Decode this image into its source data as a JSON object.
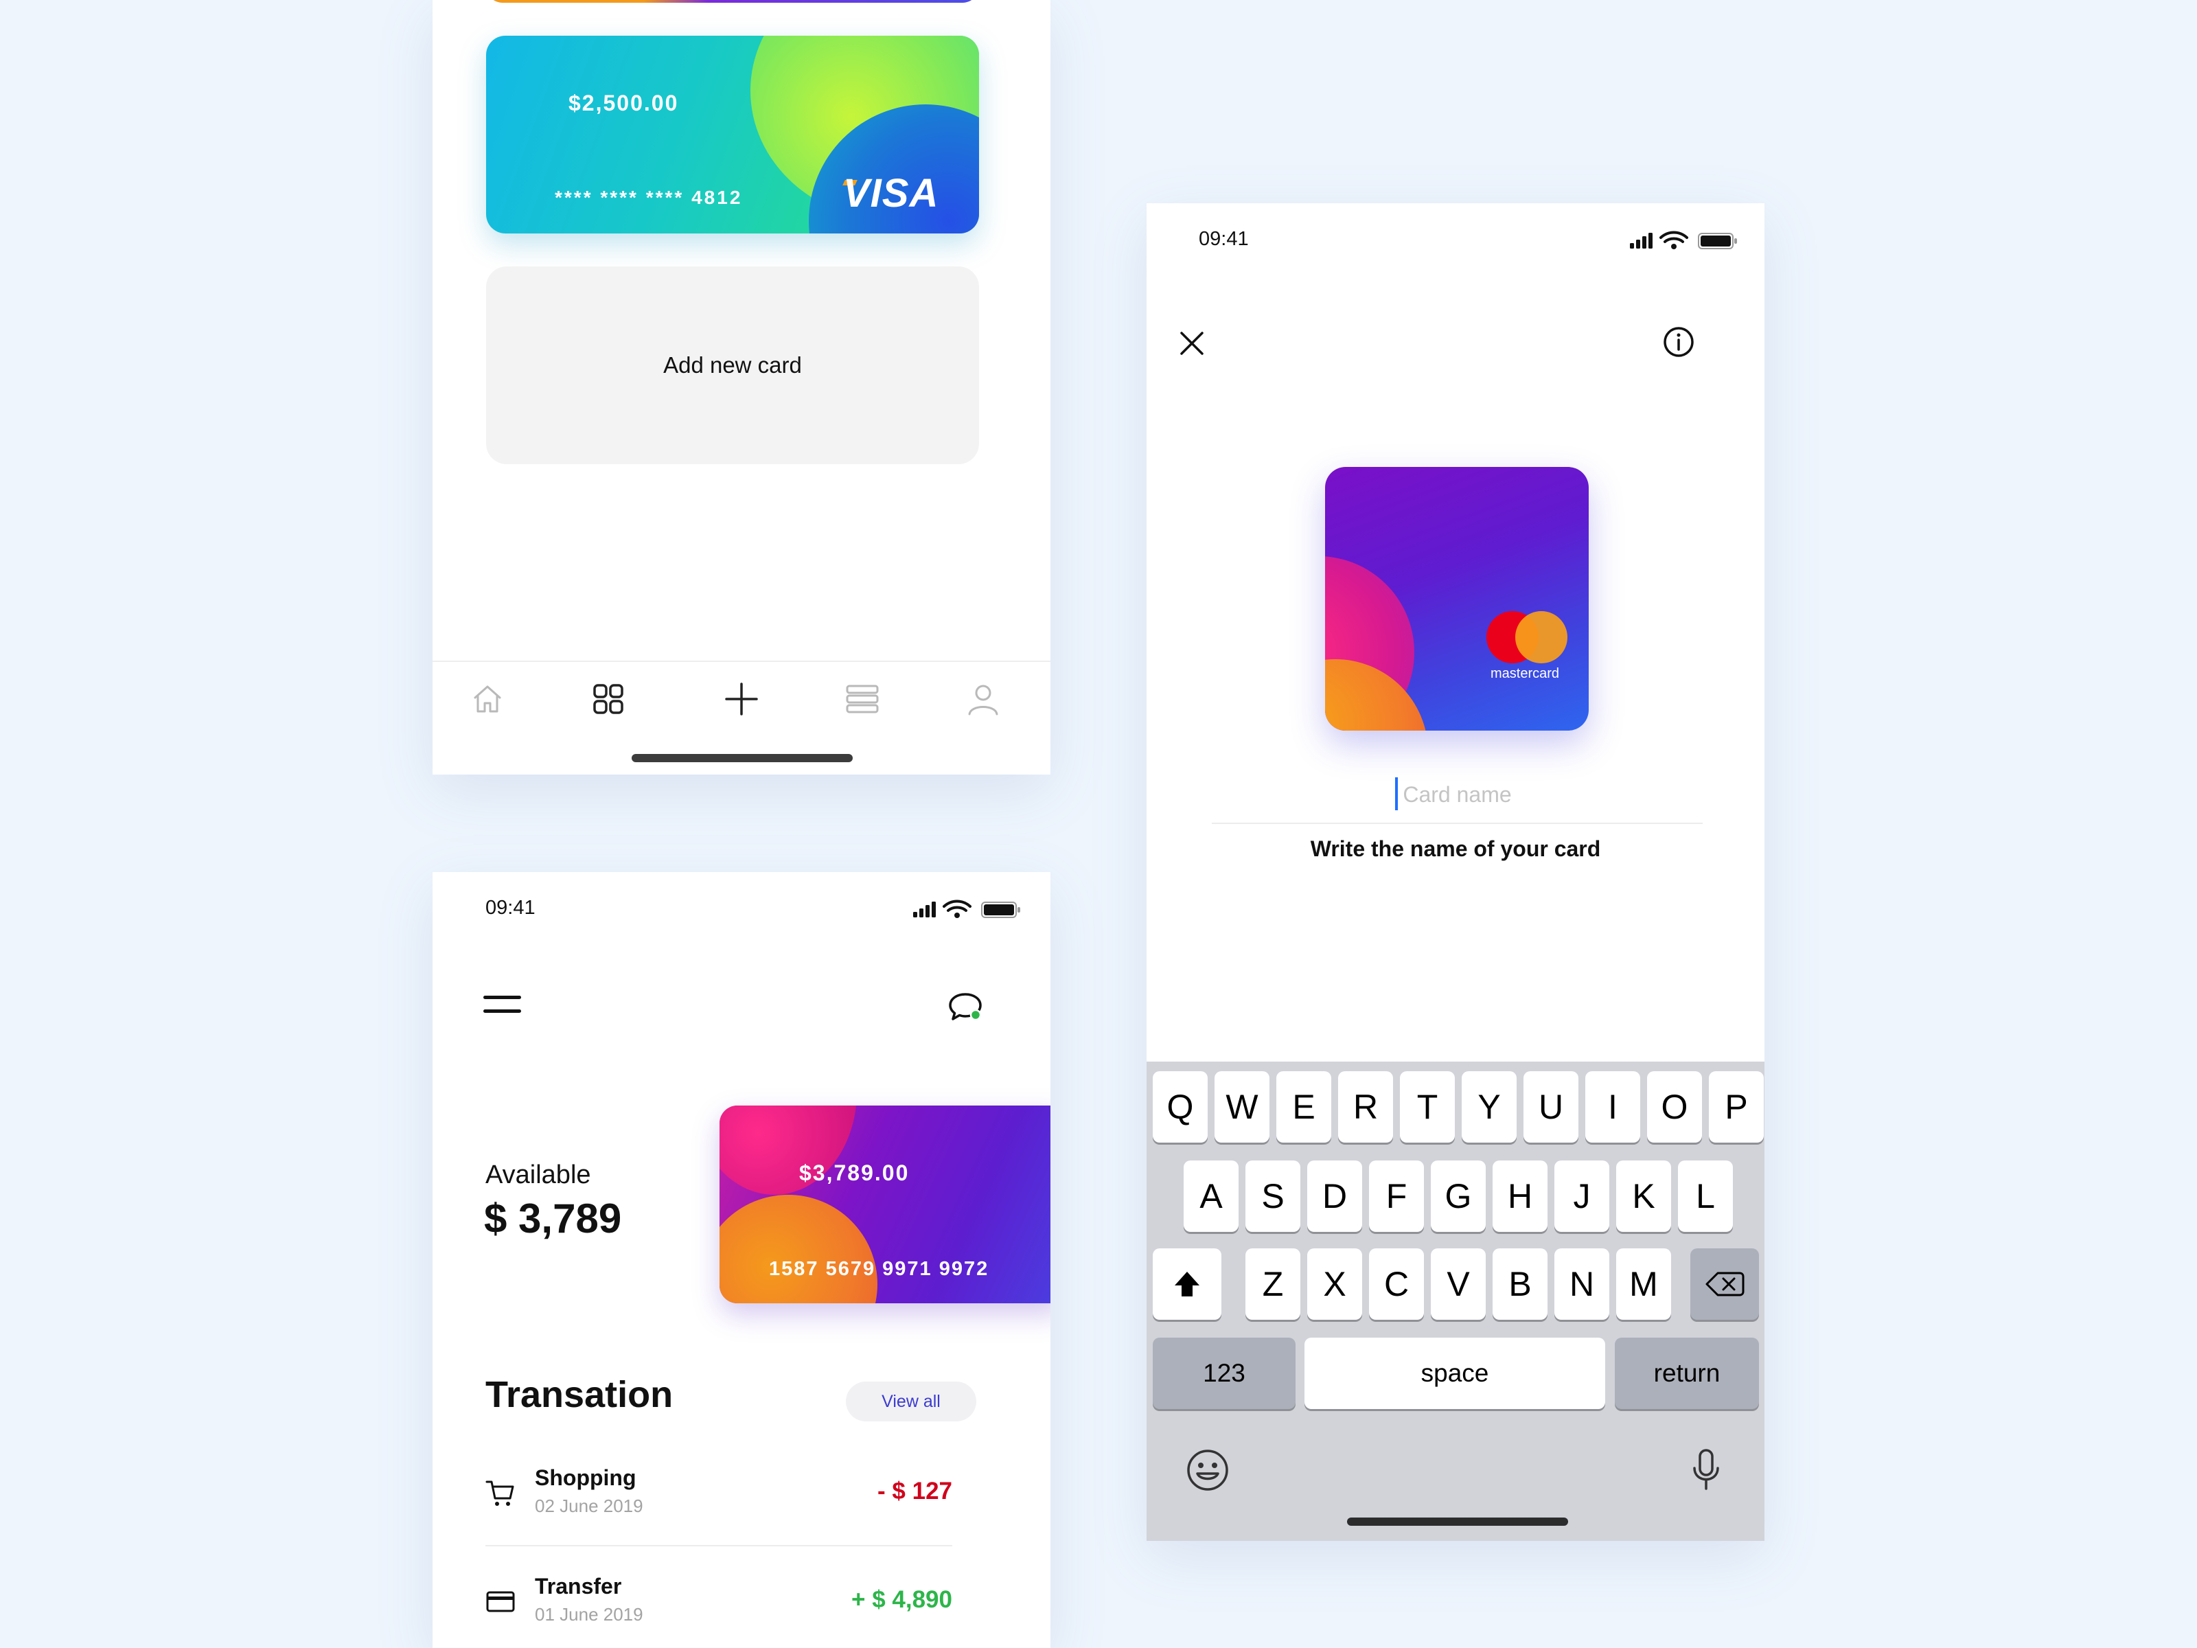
{
  "phone_cards": {
    "visa_card": {
      "amount": "$2,500.00",
      "number": "**** **** **** 4812",
      "brand": "VISA"
    },
    "add_card_label": "Add new card",
    "tabbar": {
      "items": [
        {
          "name": "home",
          "icon": "home-icon"
        },
        {
          "name": "cards",
          "icon": "grid-icon"
        },
        {
          "name": "add",
          "icon": "plus-icon"
        },
        {
          "name": "list",
          "icon": "list-icon"
        },
        {
          "name": "profile",
          "icon": "user-icon"
        }
      ],
      "active": "cards"
    }
  },
  "phone_dashboard": {
    "status_time": "09:41",
    "available_label": "Available",
    "available_amount": "$ 3,789",
    "card": {
      "amount": "$3,789.00",
      "number": "1587 5679 9971 9972"
    },
    "section_title": "Transation",
    "view_all_label": "View all",
    "transactions": [
      {
        "name": "Shopping",
        "date": "02 June 2019",
        "amount": "- $ 127",
        "type": "debit",
        "icon": "cart-icon"
      },
      {
        "name": "Transfer",
        "date": "01 June 2019",
        "amount": "+ $ 4,890",
        "type": "credit",
        "icon": "card-icon"
      }
    ],
    "colors": {
      "debit": "#d0021b",
      "credit": "#2db54a",
      "chat_dot": "#2db54a"
    }
  },
  "phone_add_card": {
    "status_time": "09:41",
    "card_brand": "mastercard",
    "input_placeholder": "Card name",
    "input_value": "",
    "hint": "Write the name of your card",
    "keyboard": {
      "row1": [
        "Q",
        "W",
        "E",
        "R",
        "T",
        "Y",
        "U",
        "I",
        "O",
        "P"
      ],
      "row2": [
        "A",
        "S",
        "D",
        "F",
        "G",
        "H",
        "J",
        "K",
        "L"
      ],
      "row3": [
        "Z",
        "X",
        "C",
        "V",
        "B",
        "N",
        "M"
      ],
      "numbers_label": "123",
      "space_label": "space",
      "return_label": "return"
    }
  },
  "colors": {
    "background": "#eef5fd",
    "accent": "#3c3bd0",
    "caret": "#1f6fff"
  }
}
